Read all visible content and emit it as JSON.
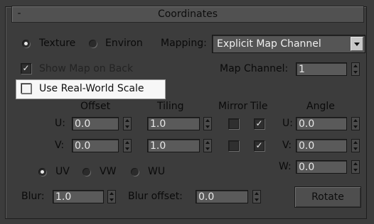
{
  "rollout": {
    "title": "Coordinates",
    "collapse_symbol": "-"
  },
  "source": {
    "texture_label": "Texture",
    "environ_label": "Environ",
    "texture_selected": true
  },
  "mapping": {
    "label": "Mapping:",
    "value": "Explicit Map Channel"
  },
  "show_map_on_back": {
    "label": "Show Map on Back",
    "checked": true
  },
  "map_channel": {
    "label": "Map Channel:",
    "value": "1"
  },
  "real_world_scale": {
    "label": "Use Real-World Scale",
    "checked": false
  },
  "columns": {
    "offset": "Offset",
    "tiling": "Tiling",
    "mirror": "Mirror",
    "tile": "Tile",
    "angle": "Angle"
  },
  "u": {
    "label": "U:",
    "offset": "0.0",
    "tiling": "1.0",
    "mirror": false,
    "tile": true,
    "angle_label": "U:",
    "angle": "0.0"
  },
  "v": {
    "label": "V:",
    "offset": "0.0",
    "tiling": "1.0",
    "mirror": false,
    "tile": true,
    "angle_label": "V:",
    "angle": "0.0"
  },
  "w": {
    "angle_label": "W:",
    "angle": "0.0"
  },
  "uvw": {
    "uv": "UV",
    "vw": "VW",
    "wu": "WU",
    "selected": "UV"
  },
  "blur": {
    "label": "Blur:",
    "value": "1.0"
  },
  "blur_offset": {
    "label": "Blur offset:",
    "value": "0.0"
  },
  "rotate_button": "Rotate",
  "check_glyph": "✓"
}
